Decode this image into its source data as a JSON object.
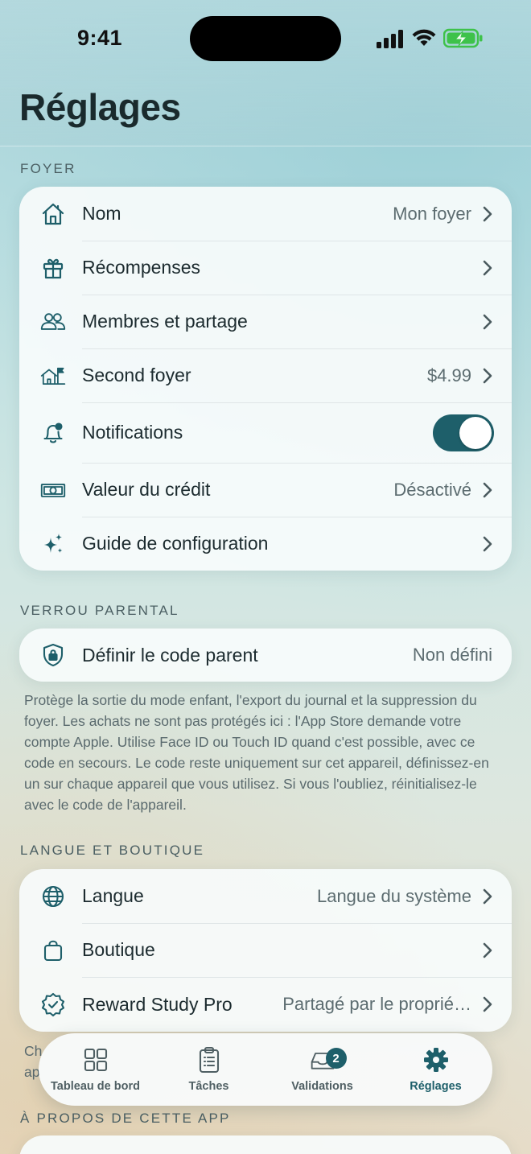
{
  "status_bar": {
    "time": "9:41"
  },
  "header": {
    "title": "Réglages"
  },
  "sections": {
    "foyer": {
      "label": "FOYER",
      "rows": [
        {
          "label": "Nom",
          "value": "Mon foyer",
          "icon": "house-icon"
        },
        {
          "label": "Récompenses",
          "value": "",
          "icon": "gift-icon"
        },
        {
          "label": "Membres et partage",
          "value": "",
          "icon": "people-icon"
        },
        {
          "label": "Second foyer",
          "value": "$4.99",
          "icon": "house-flag-icon"
        },
        {
          "label": "Notifications",
          "value": "",
          "icon": "bell-icon",
          "toggle_on": true
        },
        {
          "label": "Valeur du crédit",
          "value": "Désactivé",
          "icon": "banknote-icon"
        },
        {
          "label": "Guide de configuration",
          "value": "",
          "icon": "sparkles-icon"
        }
      ]
    },
    "verrou": {
      "label": "VERROU PARENTAL",
      "row": {
        "label": "Définir le code parent",
        "value": "Non défini",
        "icon": "shield-lock-icon"
      },
      "footnote": "Protège la sortie du mode enfant, l'export du journal et la suppression du foyer. Les achats ne sont pas protégés ici : l'App Store demande votre compte Apple. Utilise Face ID ou Touch ID quand c'est possible, avec ce code en secours. Le code reste uniquement sur cet appareil, définissez-en un sur chaque appareil que vous utilisez. Si vous l'oubliez, réinitialisez-le avec le code de l'appareil."
    },
    "langue": {
      "label": "LANGUE ET BOUTIQUE",
      "rows": [
        {
          "label": "Langue",
          "value": "Langue du système",
          "icon": "globe-icon"
        },
        {
          "label": "Boutique",
          "value": "",
          "icon": "bag-icon"
        },
        {
          "label": "Reward Study Pro",
          "value": "Partagé par le proprié…",
          "icon": "seal-check-icon"
        }
      ],
      "peek_text_1": "Ch",
      "peek_text_2": "ap"
    },
    "apropos": {
      "label": "À PROPOS DE CETTE APP"
    }
  },
  "tab_bar": {
    "tabs": [
      {
        "label": "Tableau de bord",
        "icon": "grid-icon"
      },
      {
        "label": "Tâches",
        "icon": "clipboard-icon"
      },
      {
        "label": "Validations",
        "icon": "tray-icon",
        "badge": "2"
      },
      {
        "label": "Réglages",
        "icon": "gear-icon",
        "active": true
      }
    ]
  },
  "colors": {
    "accent": "#1e5f6a",
    "battery": "#3ec24a"
  }
}
